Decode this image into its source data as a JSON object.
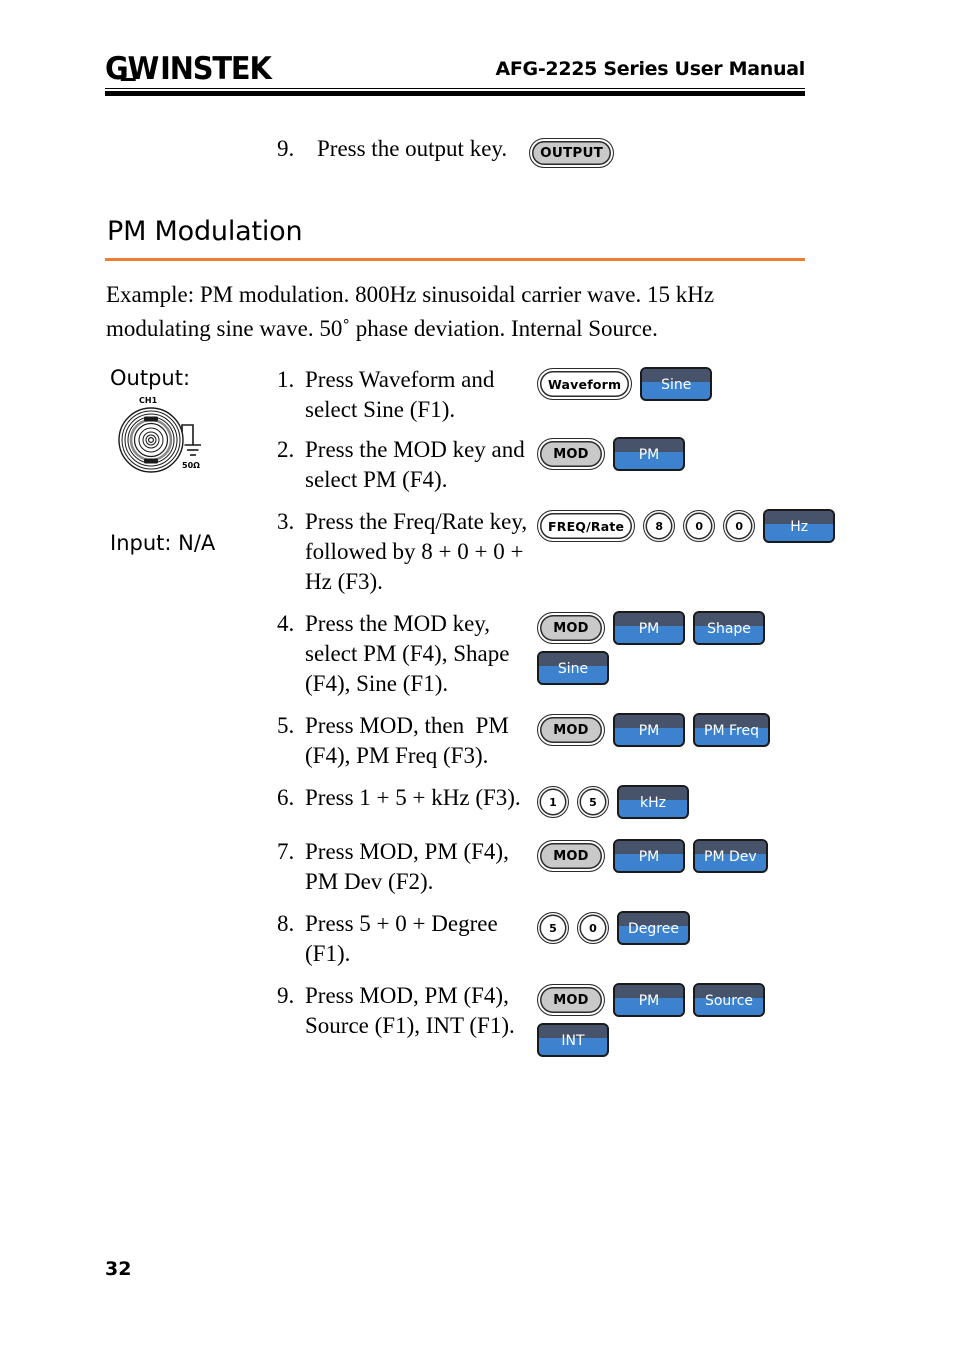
{
  "header": {
    "logo_gw": "G",
    "logo_w": "W",
    "logo_instek": "INSTEK",
    "manual_title": "AFG-2225 Series User Manual"
  },
  "top_step": {
    "number": "9.",
    "text": "Press the output key.",
    "key_label": "OUTPUT"
  },
  "section": {
    "heading": "PM Modulation",
    "accent_color": "#ED7D31",
    "example": "Example: PM modulation. 800Hz sinusoidal carrier wave. 15 kHz modulating sine wave. 50˚ phase deviation. Internal Source."
  },
  "side_labels": {
    "output": "Output:",
    "input": "Input: N/A",
    "connector_channel": "CH1",
    "connector_impedance": "50Ω"
  },
  "steps": [
    {
      "number": "1.",
      "text": "Press Waveform and select Sine (F1).",
      "rows": [
        [
          {
            "type": "pkey-light",
            "label": "Waveform"
          },
          {
            "type": "skey",
            "label": "Sine"
          }
        ]
      ]
    },
    {
      "number": "2.",
      "text": "Press the MOD key and select PM (F4).",
      "rows": [
        [
          {
            "type": "pkey",
            "label": "MOD"
          },
          {
            "type": "skey",
            "label": "PM"
          }
        ]
      ]
    },
    {
      "number": "3.",
      "text": "Press the Freq/Rate key, followed by 8 + 0 + 0 + Hz (F3).",
      "rows": [
        [
          {
            "type": "pkey-light",
            "label": "FREQ/Rate"
          },
          {
            "type": "rkey",
            "label": "8"
          },
          {
            "type": "rkey",
            "label": "0"
          },
          {
            "type": "rkey",
            "label": "0"
          },
          {
            "type": "skey",
            "label": "Hz"
          }
        ]
      ]
    },
    {
      "number": "4.",
      "text": "Press the MOD key, select PM (F4), Shape (F4), Sine (F1).",
      "rows": [
        [
          {
            "type": "pkey",
            "label": "MOD"
          },
          {
            "type": "skey",
            "label": "PM"
          },
          {
            "type": "skey",
            "label": "Shape"
          }
        ],
        [
          {
            "type": "skey",
            "label": "Sine"
          }
        ]
      ]
    },
    {
      "number": "5.",
      "text": "Press MOD, then  PM (F4), PM Freq (F3).",
      "rows": [
        [
          {
            "type": "pkey",
            "label": "MOD"
          },
          {
            "type": "skey",
            "label": "PM"
          },
          {
            "type": "skey",
            "label": "PM Freq"
          }
        ]
      ]
    },
    {
      "number": "6.",
      "text": "Press 1 + 5 + kHz (F3).",
      "rows": [
        [
          {
            "type": "rkey",
            "label": "1"
          },
          {
            "type": "rkey",
            "label": "5"
          },
          {
            "type": "skey",
            "label": "kHz"
          }
        ]
      ]
    },
    {
      "number": "7.",
      "text": "Press MOD, PM (F4), PM Dev (F2).",
      "rows": [
        [
          {
            "type": "pkey",
            "label": "MOD"
          },
          {
            "type": "skey",
            "label": "PM"
          },
          {
            "type": "skey",
            "label": "PM Dev"
          }
        ]
      ]
    },
    {
      "number": "8.",
      "text": "Press 5 + 0 + Degree (F1).",
      "rows": [
        [
          {
            "type": "rkey",
            "label": "5"
          },
          {
            "type": "rkey",
            "label": "0"
          },
          {
            "type": "skey",
            "label": "Degree"
          }
        ]
      ]
    },
    {
      "number": "9.",
      "text": "Press MOD, PM (F4), Source (F1), INT (F1).",
      "rows": [
        [
          {
            "type": "pkey",
            "label": "MOD"
          },
          {
            "type": "skey",
            "label": "PM"
          },
          {
            "type": "skey",
            "label": "Source"
          }
        ],
        [
          {
            "type": "skey",
            "label": "INT"
          }
        ]
      ]
    }
  ],
  "footer": {
    "page_number": "32"
  }
}
